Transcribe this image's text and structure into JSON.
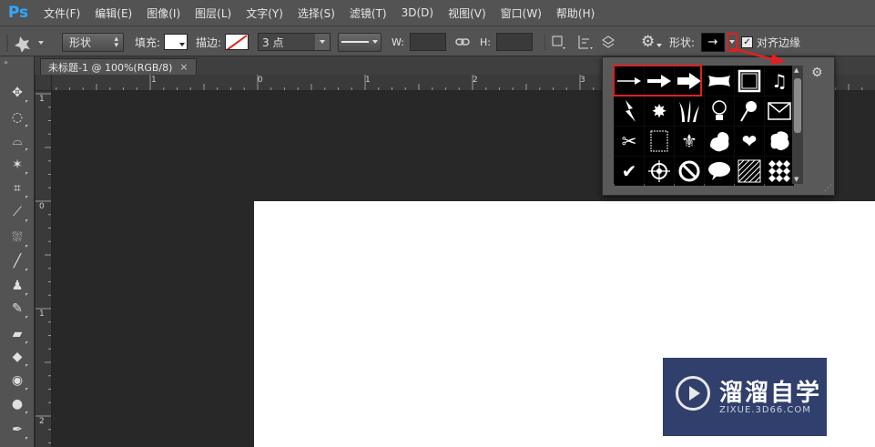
{
  "app": {
    "logo": "Ps"
  },
  "menu": [
    "文件(F)",
    "编辑(E)",
    "图像(I)",
    "图层(L)",
    "文字(Y)",
    "选择(S)",
    "滤镜(T)",
    "3D(D)",
    "视图(V)",
    "窗口(W)",
    "帮助(H)"
  ],
  "options": {
    "mode_value": "形状",
    "fill_label": "填充:",
    "stroke_label": "描边:",
    "stroke_width": "3 点",
    "w_label": "W:",
    "h_label": "H:",
    "shape_label": "形状:",
    "align_edges_label": "对齐边缘",
    "align_edges_checked": true
  },
  "document": {
    "tab_title": "未标题-1 @ 100%(RGB/8)",
    "close": "×"
  },
  "ruler": {
    "h_labels": [
      "1",
      "0",
      "1",
      "2",
      "3"
    ],
    "v_labels": [
      "1",
      "0",
      "1",
      "2"
    ]
  },
  "shapes": {
    "selected": [
      "arrow-thin",
      "arrow-medium",
      "arrow-thick"
    ],
    "items": [
      "arrow-thin",
      "arrow-medium",
      "arrow-thick",
      "banner",
      "frame",
      "music-note",
      "lightning",
      "starburst",
      "grass",
      "lightbulb",
      "pushpin",
      "envelope",
      "scissors",
      "stamp-frame",
      "fleur-de-lis",
      "puzzle-leaf",
      "heart",
      "blob",
      "checkmark",
      "target",
      "no-sign",
      "speech-bubble",
      "grid-pattern",
      "checkerboard"
    ]
  },
  "watermark": {
    "text": "溜溜自学",
    "url": "ZIXUE.3D66.COM"
  },
  "colors": {
    "accent_red": "#e02020",
    "ps_blue": "#31a8ff",
    "canvas": "#ffffff"
  }
}
